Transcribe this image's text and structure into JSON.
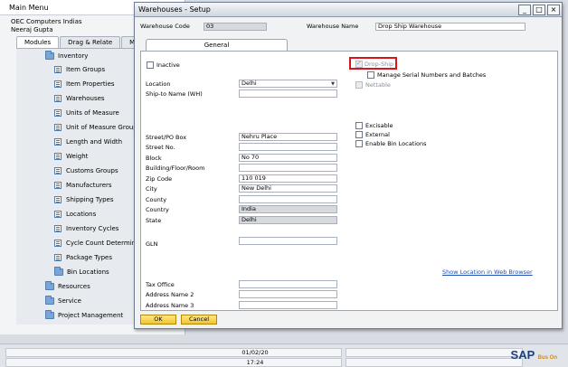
{
  "main_menu": {
    "title": "Main Menu",
    "company": "OEC Computers Indias",
    "user": "Neeraj Gupta",
    "tabs": [
      "Modules",
      "Drag & Relate",
      "M"
    ],
    "tree": {
      "inventory": "Inventory",
      "items": [
        "Item Groups",
        "Item Properties",
        "Warehouses",
        "Units of Measure",
        "Unit of Measure Groups",
        "Length and Width",
        "Weight",
        "Customs Groups",
        "Manufacturers",
        "Shipping Types",
        "Locations",
        "Inventory Cycles",
        "Cycle Count Determinat",
        "Package Types",
        "Bin Locations"
      ],
      "folders": [
        "Resources",
        "Service",
        "Project Management"
      ]
    }
  },
  "dialog": {
    "title": "Warehouses - Setup",
    "window_buttons": [
      "_",
      "□",
      "×"
    ],
    "warehouse_code_label": "Warehouse Code",
    "warehouse_code": "03",
    "warehouse_name_label": "Warehouse Name",
    "warehouse_name": "Drop Ship Warehouse",
    "tab_general": "General",
    "inactive_label": "Inactive",
    "location_label": "Location",
    "location_value": "Delhi",
    "ship_to_label": "Ship-to Name (WH)",
    "ship_to_value": "",
    "address": [
      {
        "label": "Street/PO Box",
        "value": "Nehru Place"
      },
      {
        "label": "Street No.",
        "value": ""
      },
      {
        "label": "Block",
        "value": "No 70"
      },
      {
        "label": "Building/Floor/Room",
        "value": ""
      },
      {
        "label": "Zip Code",
        "value": "110 019"
      },
      {
        "label": "City",
        "value": "New Delhi"
      },
      {
        "label": "County",
        "value": ""
      },
      {
        "label": "Country",
        "value": "India"
      },
      {
        "label": "State",
        "value": "Delhi"
      }
    ],
    "gln_label": "GLN",
    "gln_value": "",
    "tax_office_label": "Tax Office",
    "address_name_2_label": "Address Name 2",
    "address_name_3_label": "Address Name 3",
    "drop_ship_label": "Drop-Ship",
    "manage_serial_label": "Manage Serial Numbers and Batches",
    "nettable_label": "Nettable",
    "excisable_label": "Excisable",
    "external_label": "External",
    "enable_bin_label": "Enable Bin Locations",
    "web_link": "Show Location in Web Browser",
    "ok_label": "OK",
    "cancel_label": "Cancel"
  },
  "status_bar": {
    "date": "01/02/20",
    "time": "17:24",
    "logo": "SAP",
    "logo_sub": "Bus On"
  },
  "colors": {
    "highlight": "#d8141c",
    "button": "#f4c32e",
    "link": "#1f4fb5"
  }
}
